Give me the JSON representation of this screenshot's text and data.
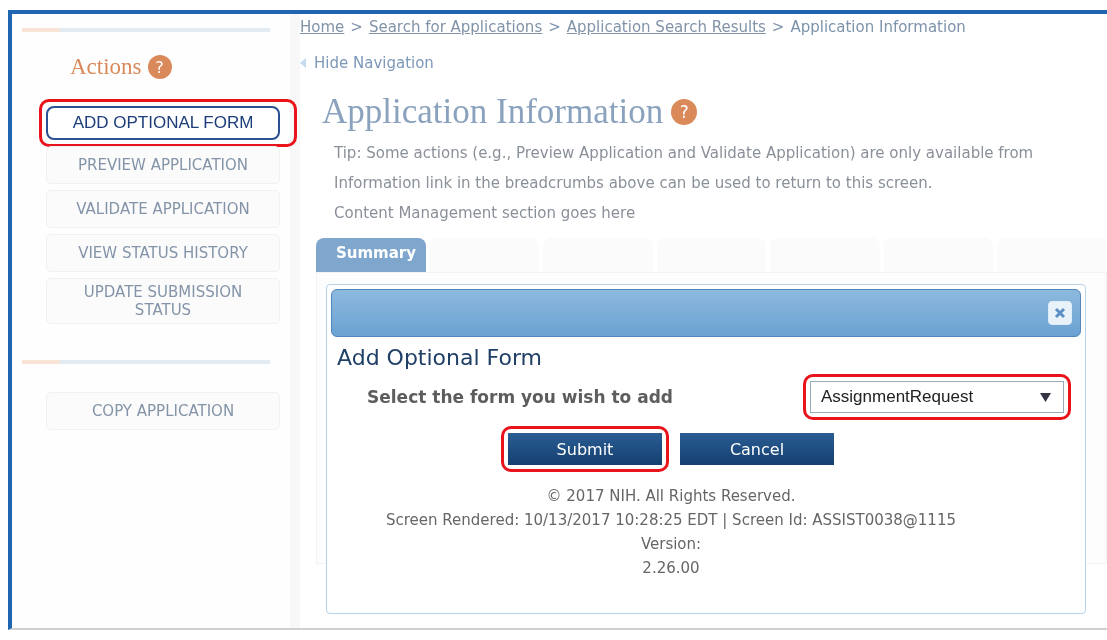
{
  "sidebar": {
    "heading": "Actions",
    "help_glyph": "?",
    "actions": [
      {
        "label": "ADD OPTIONAL FORM",
        "highlighted": true
      },
      {
        "label": "PREVIEW APPLICATION",
        "highlighted": false
      },
      {
        "label": "VALIDATE APPLICATION",
        "highlighted": false
      },
      {
        "label": "VIEW STATUS HISTORY",
        "highlighted": false
      },
      {
        "label": "UPDATE SUBMISSION STATUS",
        "highlighted": false
      }
    ],
    "secondary_actions": [
      {
        "label": "COPY APPLICATION",
        "highlighted": false
      }
    ]
  },
  "breadcrumbs": [
    {
      "label": "Home",
      "link": true
    },
    {
      "label": "Search for Applications",
      "link": true
    },
    {
      "label": "Application Search Results",
      "link": true
    },
    {
      "label": "Application Information",
      "link": false
    }
  ],
  "separator": ">",
  "hide_navigation": "Hide Navigation",
  "page_title": "Application Information",
  "title_help_glyph": "?",
  "tip": "Tip: Some actions (e.g., Preview Application and Validate Application) are only available from",
  "tip_line_2": "Information link in the breadcrumbs above can be used to return to this screen.",
  "content_note": "Content Management section goes here",
  "tabs": [
    {
      "label": "Summary",
      "selected": true
    },
    {
      "selected": false
    },
    {
      "selected": false
    },
    {
      "selected": false
    },
    {
      "selected": false
    },
    {
      "selected": false
    },
    {
      "selected": false
    }
  ],
  "dialog": {
    "title": "Add Optional Form",
    "prompt": "Select the form you wish to add",
    "select": {
      "value": "AssignmentRequest",
      "highlighted": true
    },
    "buttons": [
      {
        "label": "Submit",
        "highlighted": true
      },
      {
        "label": "Cancel",
        "highlighted": false
      }
    ],
    "footer": [
      "© 2017 NIH. All Rights Reserved.",
      "Screen Rendered: 10/13/2017 10:28:25 EDT | Screen Id: ASSIST0038@1115",
      "Version:",
      "2.26.00"
    ]
  }
}
